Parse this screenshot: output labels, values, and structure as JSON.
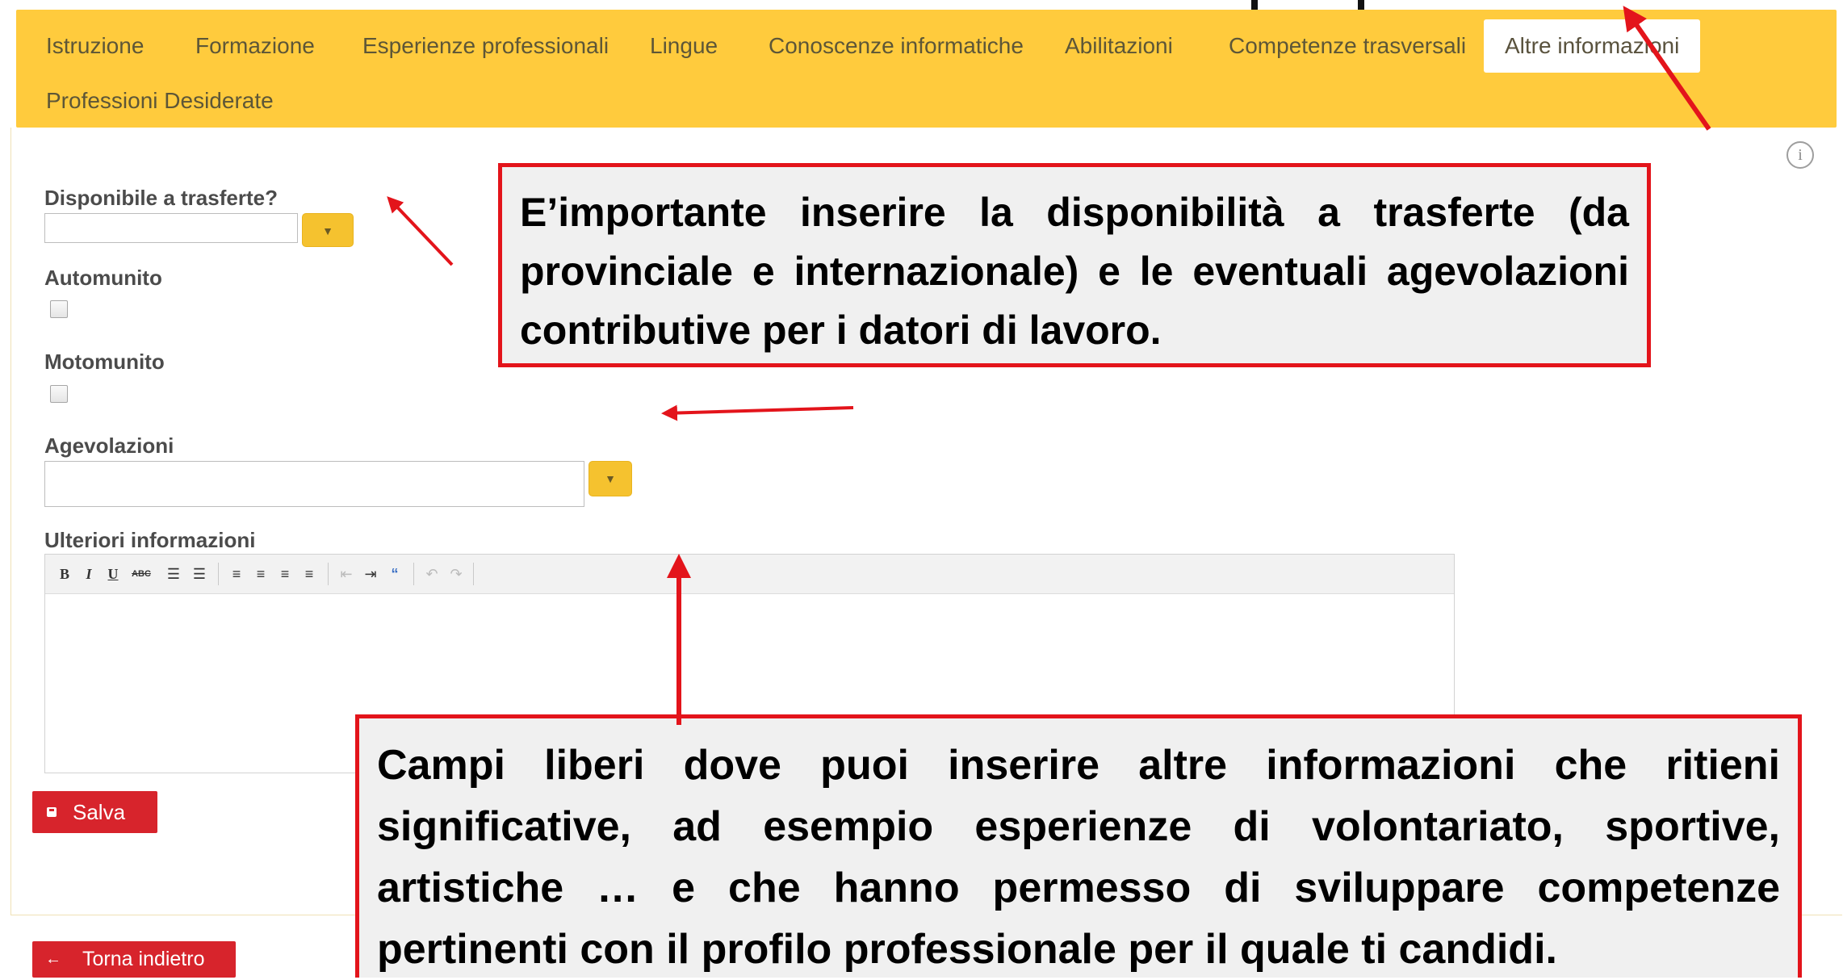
{
  "tabs": [
    {
      "label": "Istruzione",
      "active": false
    },
    {
      "label": "Formazione",
      "active": false
    },
    {
      "label": "Esperienze professionali",
      "active": false
    },
    {
      "label": "Lingue",
      "active": false
    },
    {
      "label": "Conoscenze informatiche",
      "active": false
    },
    {
      "label": "Abilitazioni",
      "active": false
    },
    {
      "label": "Competenze trasversali",
      "active": false
    },
    {
      "label": "Altre informazioni",
      "active": true
    },
    {
      "label": "Professioni Desiderate",
      "active": false
    }
  ],
  "form": {
    "trasferte_label": "Disponibile a trasferte?",
    "trasferte_value": "",
    "automunito_label": "Automunito",
    "automunito_checked": false,
    "motomunito_label": "Motomunito",
    "motomunito_checked": false,
    "agevolazioni_label": "Agevolazioni",
    "agevolazioni_value": "",
    "ulteriori_label": "Ulteriori informazioni",
    "ulteriori_value": ""
  },
  "editor_toolbar": {
    "bold": "B",
    "italic": "I",
    "underline": "U",
    "strike": "ABC",
    "quote": "“"
  },
  "buttons": {
    "salva": "Salva",
    "torna_indietro": "Torna indietro"
  },
  "annotations": {
    "note1": "E’importante inserire la disponibilità a trasferte (da provinciale e internazionale) e le eventuali agevolazioni contributive per i datori di lavoro.",
    "note2": "Campi liberi dove puoi inserire altre informazioni che ritieni significative, ad esempio esperienze di volontariato, sportive, artistiche … e che hanno permesso di sviluppare competenze pertinenti con il profilo professionale per il quale ti candidi."
  },
  "colors": {
    "tab_bar": "#ffcb3d",
    "accent_button": "#d7242c",
    "annotation_border": "#e3141b",
    "dropdown_button": "#f5c22f"
  }
}
